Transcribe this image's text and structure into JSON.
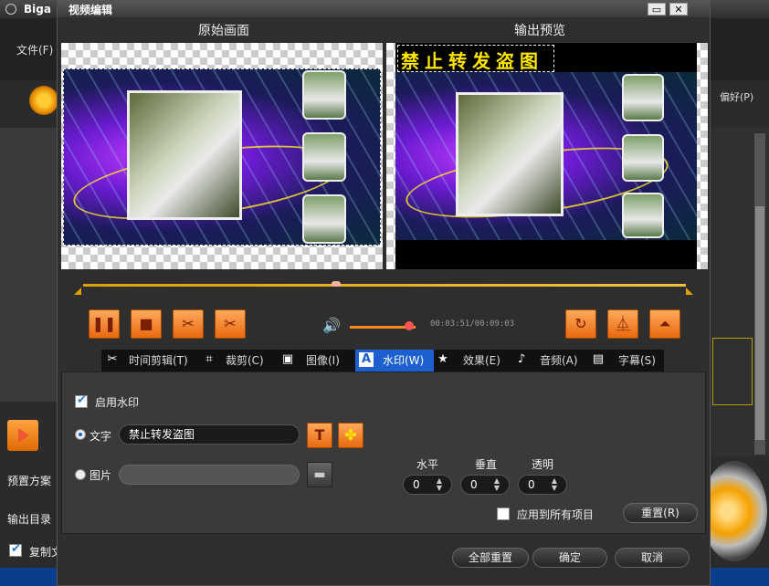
{
  "background_app": {
    "title": "Biga",
    "menu_file": "文件(F)",
    "menu_prefs": "偏好(P)",
    "preset_label": "预置方案",
    "output_dir_label": "输出目录",
    "copy_label": "复制文"
  },
  "dialog": {
    "title": "视频编辑",
    "original_label": "原始画面",
    "output_label": "输出预览",
    "watermark_preview_text": "禁止转发盗图",
    "time_display": "00:03:51/00:09:03",
    "progress_fraction": 0.42,
    "volume_fraction": 0.9,
    "tabs": [
      {
        "icon": "scissors-icon",
        "label": "时间剪辑(T)"
      },
      {
        "icon": "crop-icon",
        "label": "裁剪(C)"
      },
      {
        "icon": "image-icon",
        "label": "图像(I)"
      },
      {
        "icon": "watermark-icon",
        "label": "水印(W)",
        "active": true
      },
      {
        "icon": "star-icon",
        "label": "效果(E)"
      },
      {
        "icon": "music-icon",
        "label": "音频(A)"
      },
      {
        "icon": "subtitle-icon",
        "label": "字幕(S)"
      }
    ],
    "watermark": {
      "enable_label": "启用水印",
      "enable_checked": true,
      "text_label": "文字",
      "text_value": "禁止转发盗图",
      "image_label": "图片",
      "image_value": "",
      "horizontal_label": "水平",
      "vertical_label": "垂直",
      "opacity_label": "透明",
      "horizontal_value": "0",
      "vertical_value": "0",
      "opacity_value": "0",
      "apply_all_label": "应用到所有项目",
      "reset_label": "重置(R)"
    },
    "footer": {
      "reset_all": "全部重置",
      "ok": "确定",
      "cancel": "取消"
    }
  }
}
